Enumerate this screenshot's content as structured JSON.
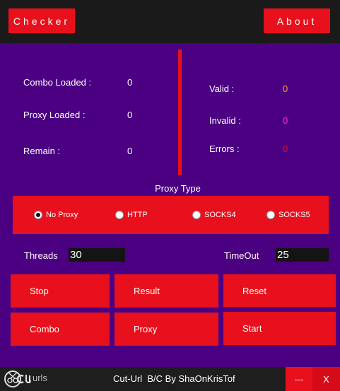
{
  "header": {
    "checker_label": "Checker",
    "about_label": "About"
  },
  "stats": {
    "combo_loaded_label": "Combo Loaded :",
    "combo_loaded_value": "0",
    "proxy_loaded_label": "Proxy Loaded :",
    "proxy_loaded_value": "0",
    "remain_label": "Remain :",
    "remain_value": "0",
    "valid_label": "Valid :",
    "valid_value": "0",
    "invalid_label": "Invalid :",
    "invalid_value": "0",
    "errors_label": "Errors :",
    "errors_value": "0"
  },
  "proxy_type": {
    "label": "Proxy Type",
    "options": [
      "No Proxy",
      "HTTP",
      "SOCKS4",
      "SOCKS5"
    ],
    "selected": "No Proxy"
  },
  "settings": {
    "threads_label": "Threads",
    "threads_value": "30",
    "timeout_label": "TimeOut",
    "timeout_value": "25"
  },
  "actions": {
    "stop": "Stop",
    "result": "Result",
    "reset": "Reset",
    "combo": "Combo",
    "proxy": "Proxy",
    "start": "Start"
  },
  "footer": {
    "logo_text": "urls",
    "credit": "Cut-Url  B/C By ShaOnKrisTof",
    "minimize_label": "---",
    "close_label": "X"
  },
  "colors": {
    "background": "#4b0082",
    "accent": "#e8101c",
    "valid_value": "#ffa040",
    "invalid_value": "#ff2dd2",
    "errors_value": "#e0102c"
  },
  "icons": {
    "logo": "cut-urls-logo-icon"
  }
}
